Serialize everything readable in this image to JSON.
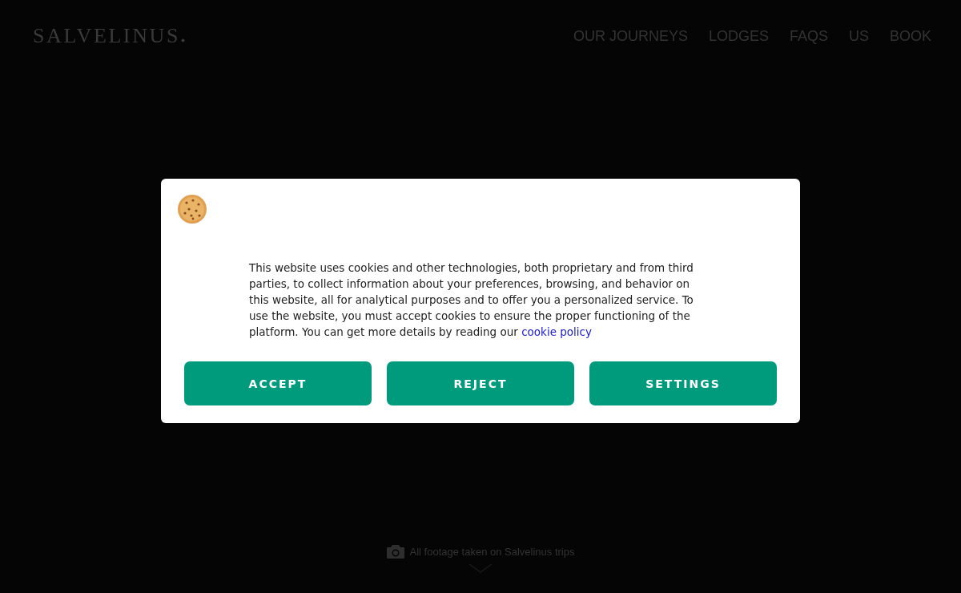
{
  "header": {
    "logo": "SALVELINUS",
    "nav": [
      {
        "label": "OUR JOURNEYS"
      },
      {
        "label": "LODGES"
      },
      {
        "label": "FAQS"
      },
      {
        "label": "US"
      },
      {
        "label": "BOOK"
      }
    ]
  },
  "footer_caption": "All footage taken on Salvelinus trips",
  "cookie_dialog": {
    "text": "This website uses cookies and other technologies, both proprietary and from third parties, to collect information about your preferences, browsing, and behavior on this website, all for analytical purposes and to offer you a personalized service. To use the website, you must accept cookies to ensure the proper functioning of the platform. You can get more details by reading our",
    "link": "cookie policy",
    "buttons": [
      {
        "label": "ACCEPT"
      },
      {
        "label": "REJECT"
      },
      {
        "label": "SETTINGS"
      }
    ]
  }
}
